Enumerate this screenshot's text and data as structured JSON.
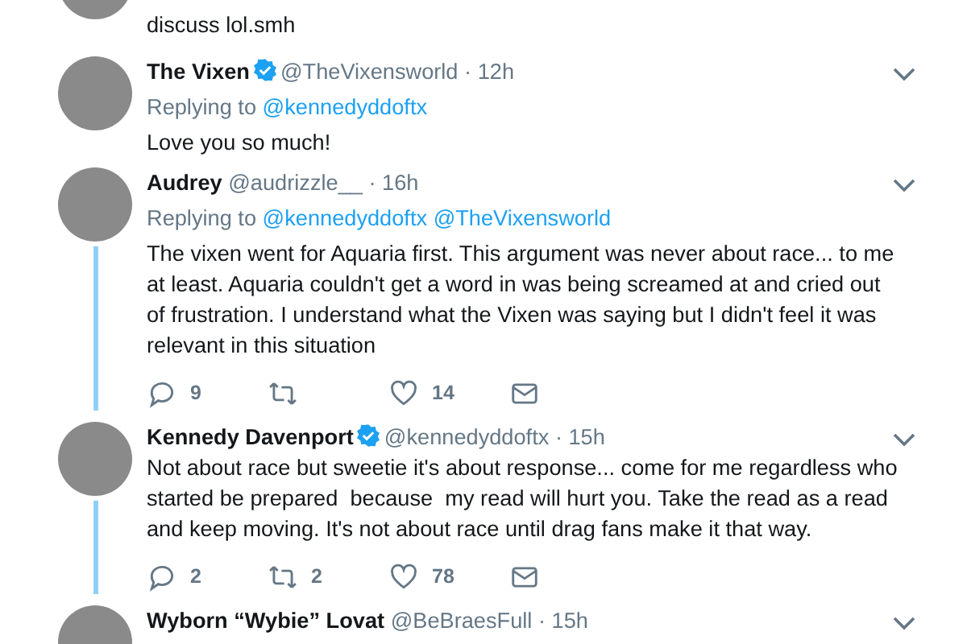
{
  "tweets": [
    {
      "kind": "cut_top",
      "text": "discuss lol.smh"
    },
    {
      "kind": "full",
      "name": "The Vixen",
      "verified": true,
      "handle": "@TheVixensworld",
      "time": "· 12h",
      "replying_label": "Replying to",
      "reply_to": [
        "@kennedyddoftx"
      ],
      "text": "Love you so much!",
      "thread_line": false
    },
    {
      "kind": "full",
      "name": "Audrey",
      "verified": false,
      "handle": "@audrizzle__",
      "time": "· 16h",
      "replying_label": "Replying to",
      "reply_to": [
        "@kennedyddoftx",
        "@TheVixensworld"
      ],
      "text": "The vixen went for Aquaria first. This argument was never about race... to me at least. Aquaria couldn't get a word in was being screamed at and cried out of frustration. I understand what the Vixen was saying but I didn't feel it was relevant in this situation",
      "actions": {
        "replies": "9",
        "likes": "14"
      },
      "thread_line": true
    },
    {
      "kind": "full",
      "name": "Kennedy Davenport",
      "verified": true,
      "handle": "@kennedyddoftx",
      "time": "· 15h",
      "text": "Not about race but sweetie it's about response... come for me regardless who started be prepared  because  my read will hurt you. Take the read as a read and keep moving. It's not about race until drag fans make it that way.",
      "actions": {
        "replies": "2",
        "retweets": "2",
        "likes": "78"
      },
      "thread_line": true
    },
    {
      "kind": "cut_bottom",
      "name": "Wyborn “Wybie” Lovat",
      "verified": false,
      "handle": "@BeBraesFull",
      "time": "· 15h"
    }
  ]
}
